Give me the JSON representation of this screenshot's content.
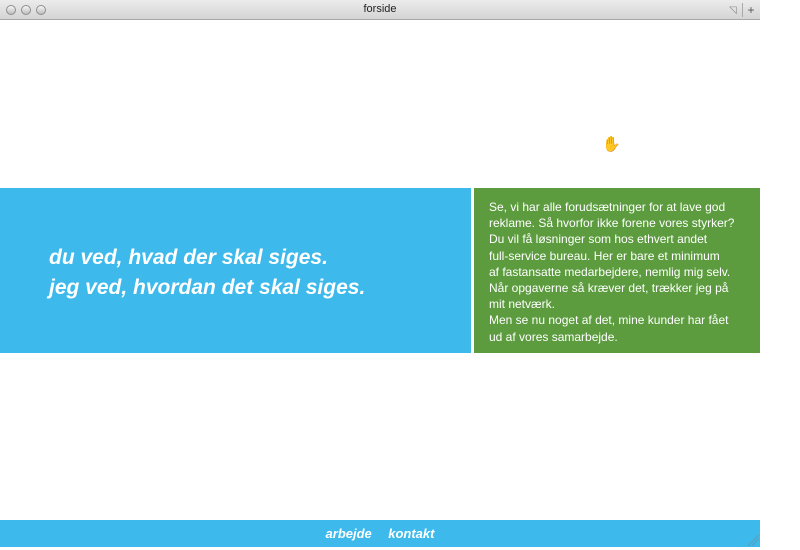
{
  "window": {
    "title": "forside",
    "add_tab_glyph": "+",
    "resize_glyph": "◹"
  },
  "cursor": {
    "glyph": "✋"
  },
  "hero": {
    "tagline": [
      "du ved, hvad der skal siges.",
      "jeg ved, hvordan det skal siges."
    ]
  },
  "about": {
    "lines": [
      "Se, vi har alle forudsætninger for at lave god",
      "reklame. Så hvorfor ikke forene vores styrker?",
      "Du vil få løsninger som hos ethvert andet",
      "full-service bureau. Her er bare et minimum",
      "af fastansatte medarbejdere, nemlig mig selv.",
      "Når opgaverne så kræver det, trækker jeg på",
      "mit netværk.",
      "Men se nu noget af det, mine kunder har fået",
      "ud af vores samarbejde."
    ]
  },
  "footer": {
    "links": [
      "arbejde",
      "kontakt"
    ]
  },
  "colors": {
    "blue": "#3db9ec",
    "green": "#5c9c3f",
    "text": "#ffffff"
  },
  "icons": [
    "close-icon",
    "minimize-icon",
    "maximize-icon",
    "hand-cursor-icon",
    "resize-grip-icon"
  ]
}
